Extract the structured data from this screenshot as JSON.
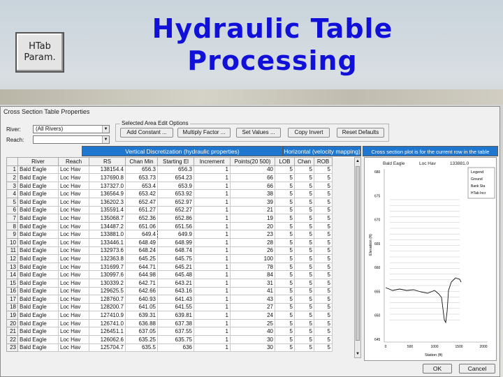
{
  "slide": {
    "title_line1": "Hydraulic Table",
    "title_line2": "Processing",
    "button_line1": "HTab",
    "button_line2": "Param."
  },
  "dialog": {
    "title": "Cross Section Table Properties",
    "river_label": "River:",
    "river_value": "(All Rivers)",
    "reach_label": "Reach:",
    "reach_value": "",
    "group_title": "Selected Area Edit Options",
    "buttons": [
      "Add Constant ...",
      "Multiply Factor ...",
      "Set Values ...",
      "Copy Invert",
      "Reset Defaults"
    ],
    "band_vertical": "Vertical Discretization (hydraulic properties)",
    "band_horizontal": "Horizontal (velocity mapping)",
    "band_plot": "Cross section plot is for the current row in the table",
    "columns": [
      "",
      "River",
      "Reach",
      "RS",
      "Chan Min",
      "Starting El",
      "Increment",
      "Points(20 500)",
      "LOB",
      "Chan",
      "ROB"
    ],
    "rows": [
      [
        "1",
        "Bald Eagle",
        "Loc Hav",
        "138154.4",
        "656.3",
        "656.3",
        "1",
        "40",
        "5",
        "5",
        "5"
      ],
      [
        "2",
        "Bald Eagle",
        "Loc Hav",
        "137690.8",
        "653.73",
        "654.23",
        "1",
        "66",
        "5",
        "5",
        "5"
      ],
      [
        "3",
        "Bald Eagle",
        "Loc Hav",
        "137327.0",
        "653.4",
        "653.9",
        "1",
        "66",
        "5",
        "5",
        "5"
      ],
      [
        "4",
        "Bald Eagle",
        "Loc Hav",
        "136564.9",
        "653.42",
        "653.92",
        "1",
        "38",
        "5",
        "5",
        "5"
      ],
      [
        "5",
        "Bald Eagle",
        "Loc Hav",
        "136202.3",
        "652.47",
        "652.97",
        "1",
        "39",
        "5",
        "5",
        "5"
      ],
      [
        "6",
        "Bald Eagle",
        "Loc Hav",
        "135591.4",
        "651.27",
        "652.27",
        "1",
        "21",
        "5",
        "5",
        "5"
      ],
      [
        "7",
        "Bald Eagle",
        "Loc Hav",
        "135068.7",
        "652.36",
        "652.86",
        "1",
        "19",
        "5",
        "5",
        "5"
      ],
      [
        "8",
        "Bald Eagle",
        "Loc Hav",
        "134487.2",
        "651.06",
        "651.56",
        "1",
        "20",
        "5",
        "5",
        "5"
      ],
      [
        "9",
        "Bald Eagle",
        "Loc Hav",
        "133881.0",
        "649.4",
        "649.9",
        "1",
        "23",
        "5",
        "5",
        "5"
      ],
      [
        "10",
        "Bald Eagle",
        "Loc Hav",
        "133446.1",
        "648.49",
        "648.99",
        "1",
        "28",
        "5",
        "5",
        "5"
      ],
      [
        "11",
        "Bald Eagle",
        "Loc Hav",
        "132973.6",
        "648.24",
        "648.74",
        "1",
        "26",
        "5",
        "5",
        "5"
      ],
      [
        "12",
        "Bald Eagle",
        "Loc Hav",
        "132363.8",
        "645.25",
        "645.75",
        "1",
        "100",
        "5",
        "5",
        "5"
      ],
      [
        "13",
        "Bald Eagle",
        "Loc Hav",
        "131699.7",
        "644.71",
        "645.21",
        "1",
        "78",
        "5",
        "5",
        "5"
      ],
      [
        "14",
        "Bald Eagle",
        "Loc Hav",
        "130997.6",
        "644.98",
        "645.48",
        "1",
        "84",
        "5",
        "5",
        "5"
      ],
      [
        "15",
        "Bald Eagle",
        "Loc Hav",
        "130339.2",
        "642.71",
        "643.21",
        "1",
        "31",
        "5",
        "5",
        "5"
      ],
      [
        "16",
        "Bald Eagle",
        "Loc Hav",
        "129625.5",
        "642.66",
        "643.16",
        "1",
        "41",
        "5",
        "5",
        "5"
      ],
      [
        "17",
        "Bald Eagle",
        "Loc Hav",
        "128760.7",
        "640.93",
        "641.43",
        "1",
        "43",
        "5",
        "5",
        "5"
      ],
      [
        "18",
        "Bald Eagle",
        "Loc Hav",
        "128200.7",
        "641.05",
        "641.55",
        "1",
        "27",
        "5",
        "5",
        "5"
      ],
      [
        "19",
        "Bald Eagle",
        "Loc Hav",
        "127410.9",
        "639.31",
        "639.81",
        "1",
        "24",
        "5",
        "5",
        "5"
      ],
      [
        "20",
        "Bald Eagle",
        "Loc Hav",
        "126741.0",
        "636.88",
        "637.38",
        "1",
        "25",
        "5",
        "5",
        "5"
      ],
      [
        "21",
        "Bald Eagle",
        "Loc Hav",
        "126451.1",
        "637.05",
        "637.55",
        "1",
        "40",
        "5",
        "5",
        "5"
      ],
      [
        "22",
        "Bald Eagle",
        "Loc Hav",
        "126062.6",
        "635.25",
        "635.75",
        "1",
        "30",
        "5",
        "5",
        "5"
      ],
      [
        "23",
        "Bald Eagle",
        "Loc Hav",
        "125704.7",
        "635.5",
        "636",
        "1",
        "30",
        "5",
        "5",
        "5"
      ]
    ],
    "plot": {
      "header_river": "Bald Eagle",
      "header_reach": "Loc Hav",
      "header_rs": "133881.0",
      "legend_title": "Legend",
      "legend_items": [
        "Ground",
        "Bank Sta",
        "HTab Incr"
      ],
      "ylabel": "Elevation (ft)",
      "xlabel": "Station (ft)",
      "yticks": [
        "680",
        "675",
        "670",
        "665",
        "660",
        "655",
        "650",
        "645"
      ],
      "xticks": [
        "0",
        "500",
        "1000",
        "1500",
        "2000"
      ]
    },
    "ok_label": "OK",
    "cancel_label": "Cancel"
  },
  "colors": {
    "title": "#1010d8",
    "band": "#1e76ce"
  }
}
